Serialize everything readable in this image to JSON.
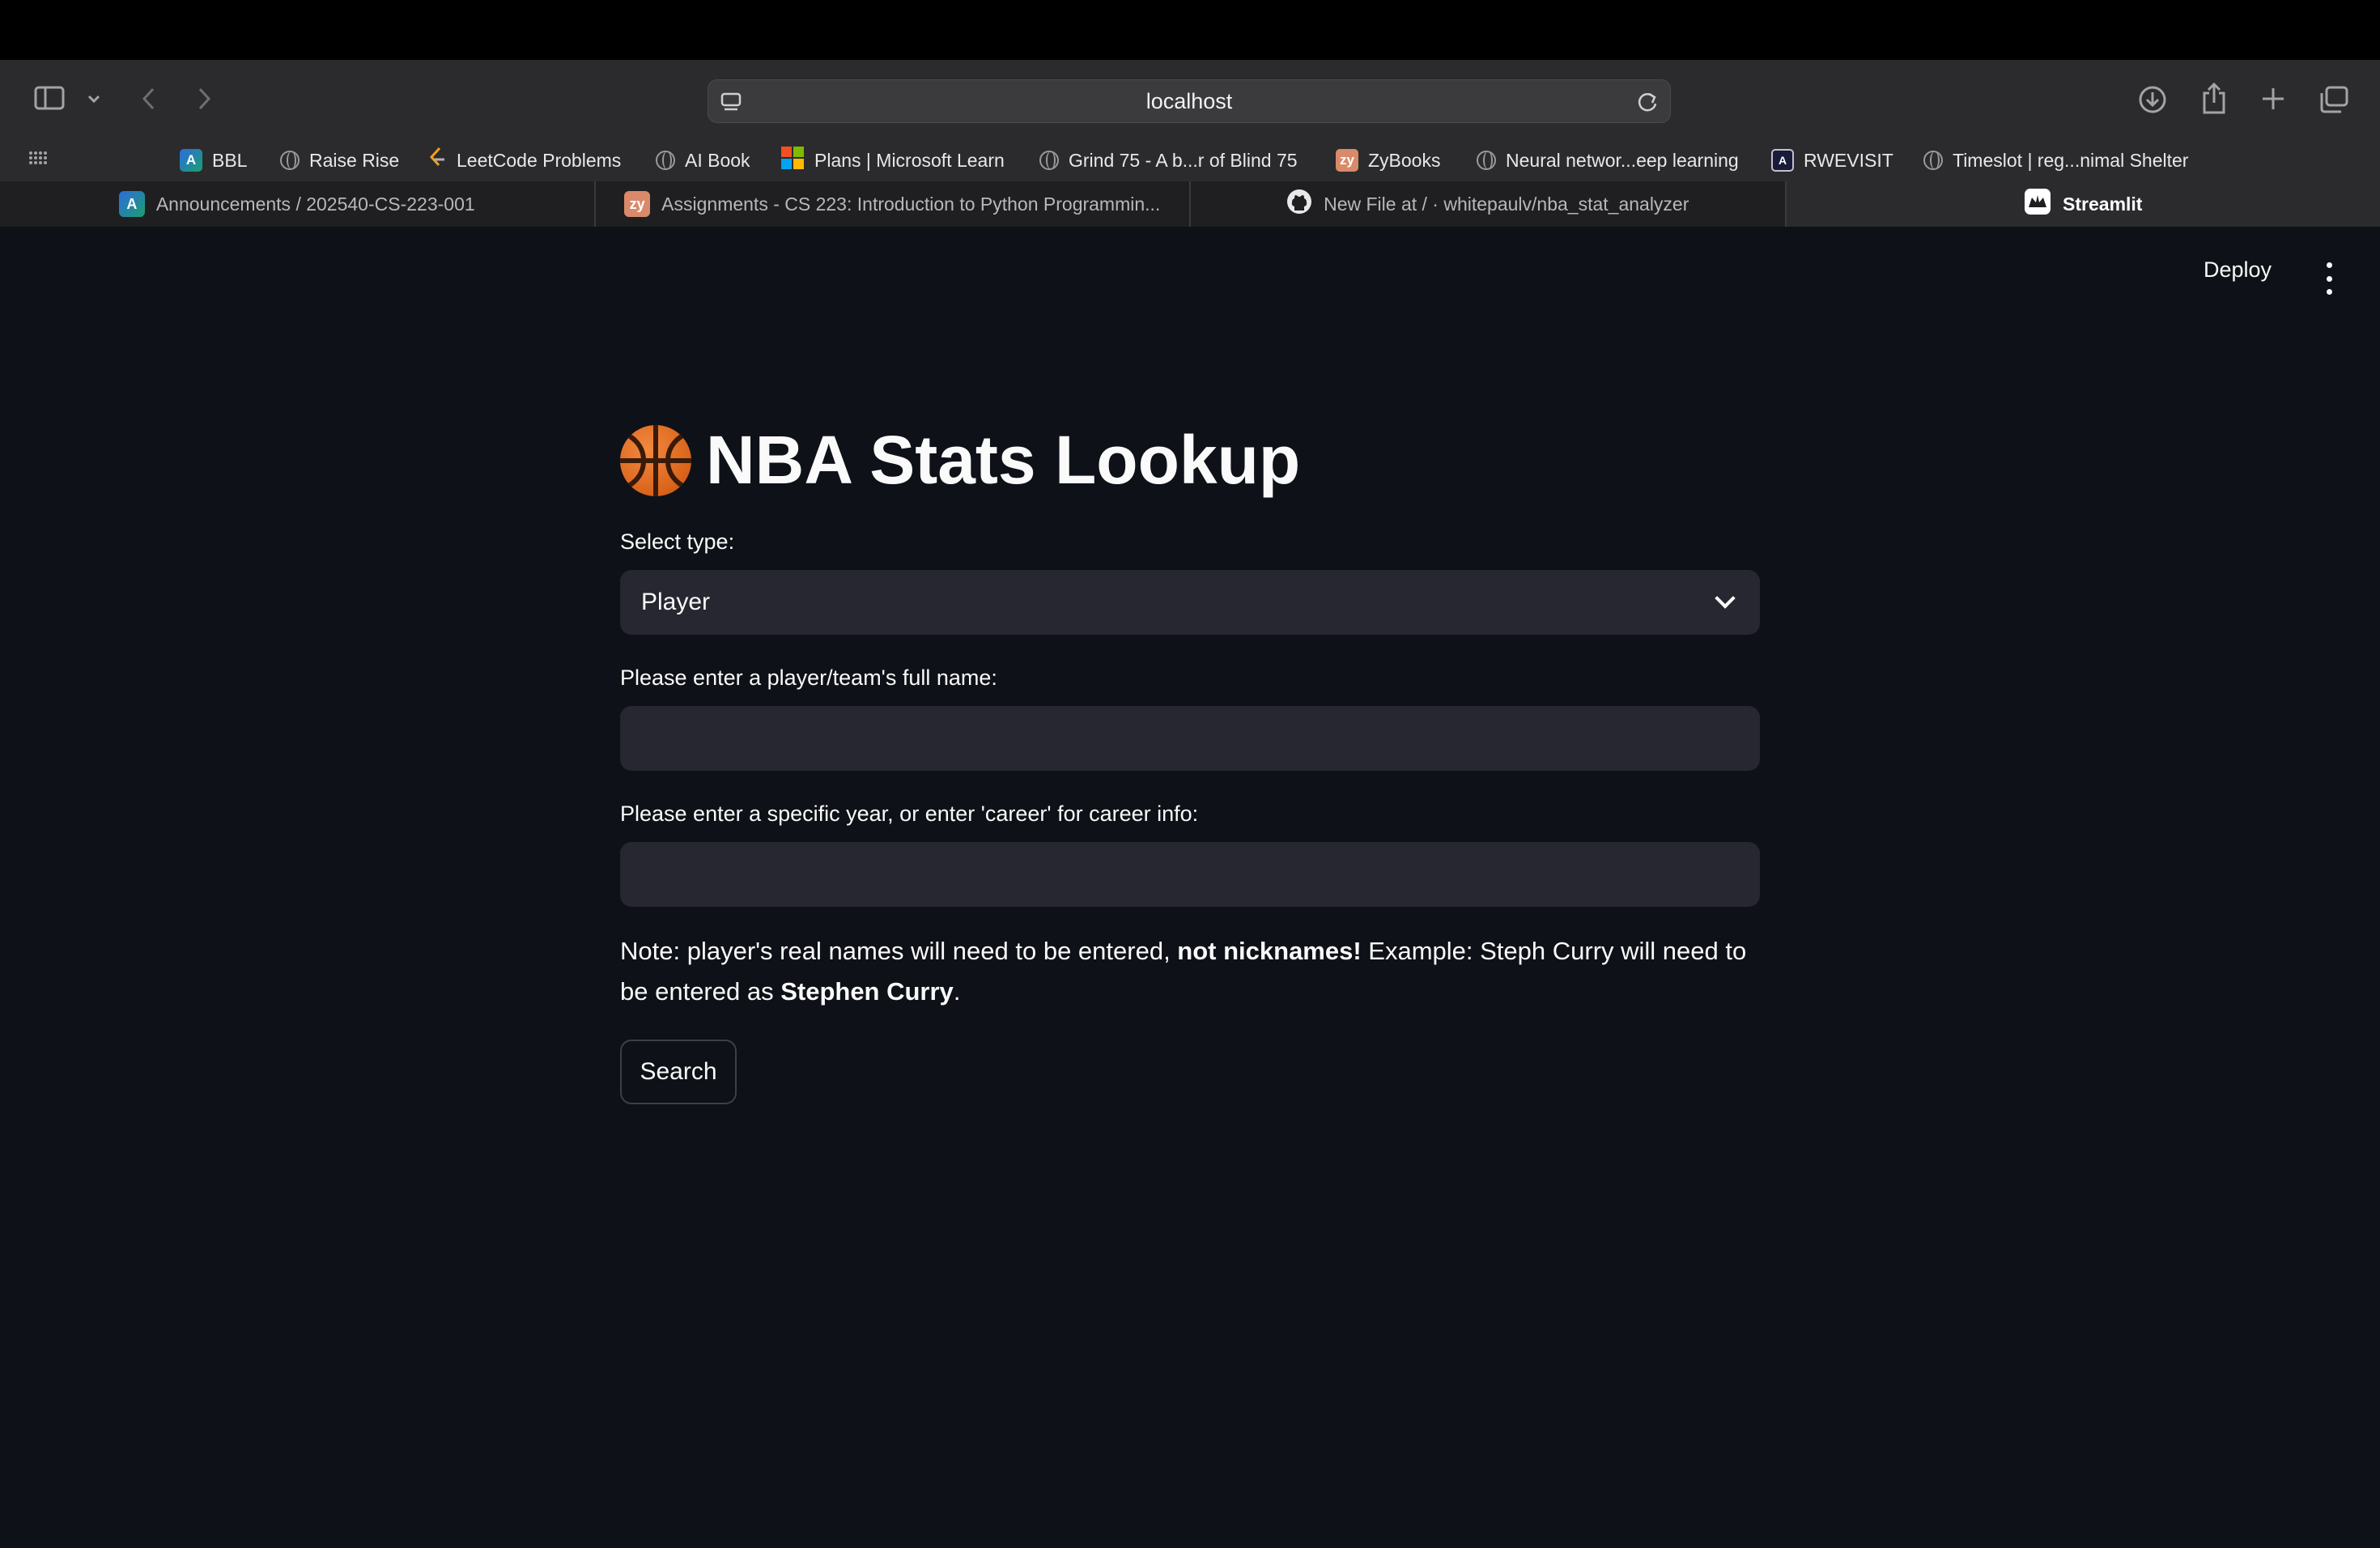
{
  "browser": {
    "url": "localhost",
    "bookmarks": [
      {
        "label": "BBL",
        "icon": "canvas-icon"
      },
      {
        "label": "Raise Rise",
        "icon": "globe-icon"
      },
      {
        "label": "LeetCode Problems",
        "icon": "leetcode-icon"
      },
      {
        "label": "AI Book",
        "icon": "globe-icon"
      },
      {
        "label": "Plans | Microsoft Learn",
        "icon": "microsoft-icon"
      },
      {
        "label": "Grind 75 - A b...r of Blind 75",
        "icon": "globe-icon"
      },
      {
        "label": "ZyBooks",
        "icon": "zybooks-icon"
      },
      {
        "label": "Neural networ...eep learning",
        "icon": "globe-icon"
      },
      {
        "label": "RWEVISIT",
        "icon": "rwevisit-icon"
      },
      {
        "label": "Timeslot | reg...nimal Shelter",
        "icon": "globe-icon"
      }
    ],
    "tabs": [
      {
        "label": "Announcements / 202540-CS-223-001",
        "icon": "canvas-icon",
        "active": false
      },
      {
        "label": "Assignments - CS 223: Introduction to Python Programmin...",
        "icon": "zybooks-icon",
        "active": false
      },
      {
        "label": "New File at / · whitepaulv/nba_stat_analyzer",
        "icon": "github-icon",
        "active": false
      },
      {
        "label": "Streamlit",
        "icon": "streamlit-icon",
        "active": true
      }
    ]
  },
  "app": {
    "deploy_label": "Deploy",
    "title": "NBA Stats Lookup",
    "type_label": "Select type:",
    "type_value": "Player",
    "name_label": "Please enter a player/team's full name:",
    "name_value": "",
    "year_label": "Please enter a specific year, or enter 'career' for career info:",
    "year_value": "",
    "note": {
      "part1": "Note: player's real names will need to be entered, ",
      "bold1": "not nicknames!",
      "part2": " Example: Steph Curry will need to be entered as ",
      "bold2": "Stephen Curry",
      "part3": "."
    },
    "search_label": "Search"
  },
  "colors": {
    "app_background": "#0e1117",
    "input_background": "#262730",
    "browser_chrome": "#2b2b2d",
    "text": "#fafafa"
  }
}
